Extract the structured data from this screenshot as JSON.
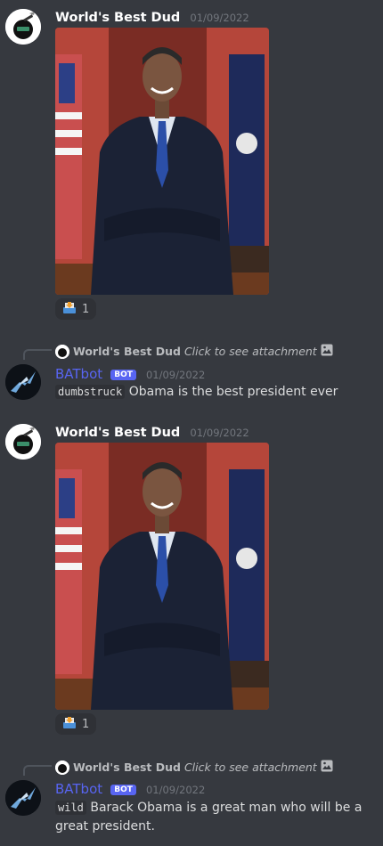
{
  "messages": [
    {
      "author": "World's Best Dud",
      "timestamp": "01/09/2022",
      "reaction_count": "1"
    },
    {
      "reply_author": "World's Best Dud",
      "reply_text": "Click to see attachment",
      "author": "BATbot",
      "badge": "BOT",
      "timestamp": "01/09/2022",
      "code": "dumbstruck",
      "text": "Obama is the best president ever"
    },
    {
      "author": "World's Best Dud",
      "timestamp": "01/09/2022",
      "reaction_count": "1"
    },
    {
      "reply_author": "World's Best Dud",
      "reply_text": "Click to see attachment",
      "author": "BATbot",
      "badge": "BOT",
      "timestamp": "01/09/2022",
      "code": "wild",
      "text": "Barack Obama is a great man who will be a great president."
    }
  ],
  "colors": {
    "background": "#36393f",
    "bot_name": "#5865f2",
    "bot_badge": "#5865f2",
    "timestamp": "#72767d"
  },
  "icons": {
    "reaction_emoji": "inbox-tray-icon",
    "attachment": "image-icon"
  }
}
